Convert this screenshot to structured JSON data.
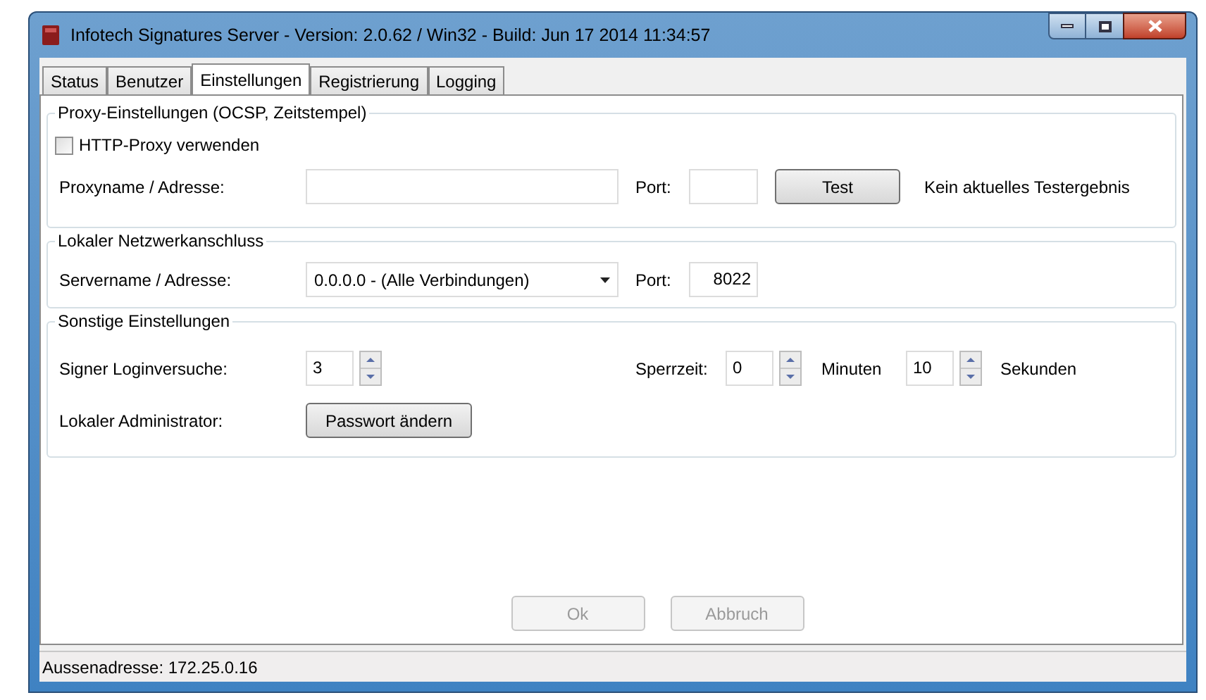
{
  "window": {
    "title": "Infotech Signatures Server - Version: 2.0.62 / Win32 - Build: Jun 17 2014 11:34:57"
  },
  "tabs": [
    {
      "label": "Status",
      "selected": false
    },
    {
      "label": "Benutzer",
      "selected": false
    },
    {
      "label": "Einstellungen",
      "selected": true
    },
    {
      "label": "Registrierung",
      "selected": false
    },
    {
      "label": "Logging",
      "selected": false
    }
  ],
  "proxy_group": {
    "legend": "Proxy-Einstellungen (OCSP, Zeitstempel)",
    "use_proxy": {
      "label": "HTTP-Proxy verwenden",
      "checked": false
    },
    "proxy_label": "Proxyname / Adresse:",
    "port_label": "Port:",
    "test_button": "Test",
    "test_result": "Kein aktuelles Testergebnis"
  },
  "network_group": {
    "legend": "Lokaler Netzwerkanschluss",
    "server_label": "Servername / Adresse:",
    "server_value": "0.0.0.0 - (Alle Verbindungen)",
    "port_label": "Port:",
    "port_value": "8022"
  },
  "other_group": {
    "legend": "Sonstige Einstellungen",
    "login_label": "Signer Loginversuche:",
    "login_value": "3",
    "lock_label": "Sperrzeit:",
    "minutes_value": "0",
    "minutes_label": "Minuten",
    "seconds_value": "10",
    "seconds_label": "Sekunden",
    "admin_label": "Lokaler Administrator:",
    "password_button": "Passwort ändern"
  },
  "buttons": [
    {
      "label": "Ok",
      "disabled": true
    },
    {
      "label": "Abbruch",
      "disabled": true
    }
  ],
  "status_bar": "Aussenadresse: 172.25.0.16"
}
